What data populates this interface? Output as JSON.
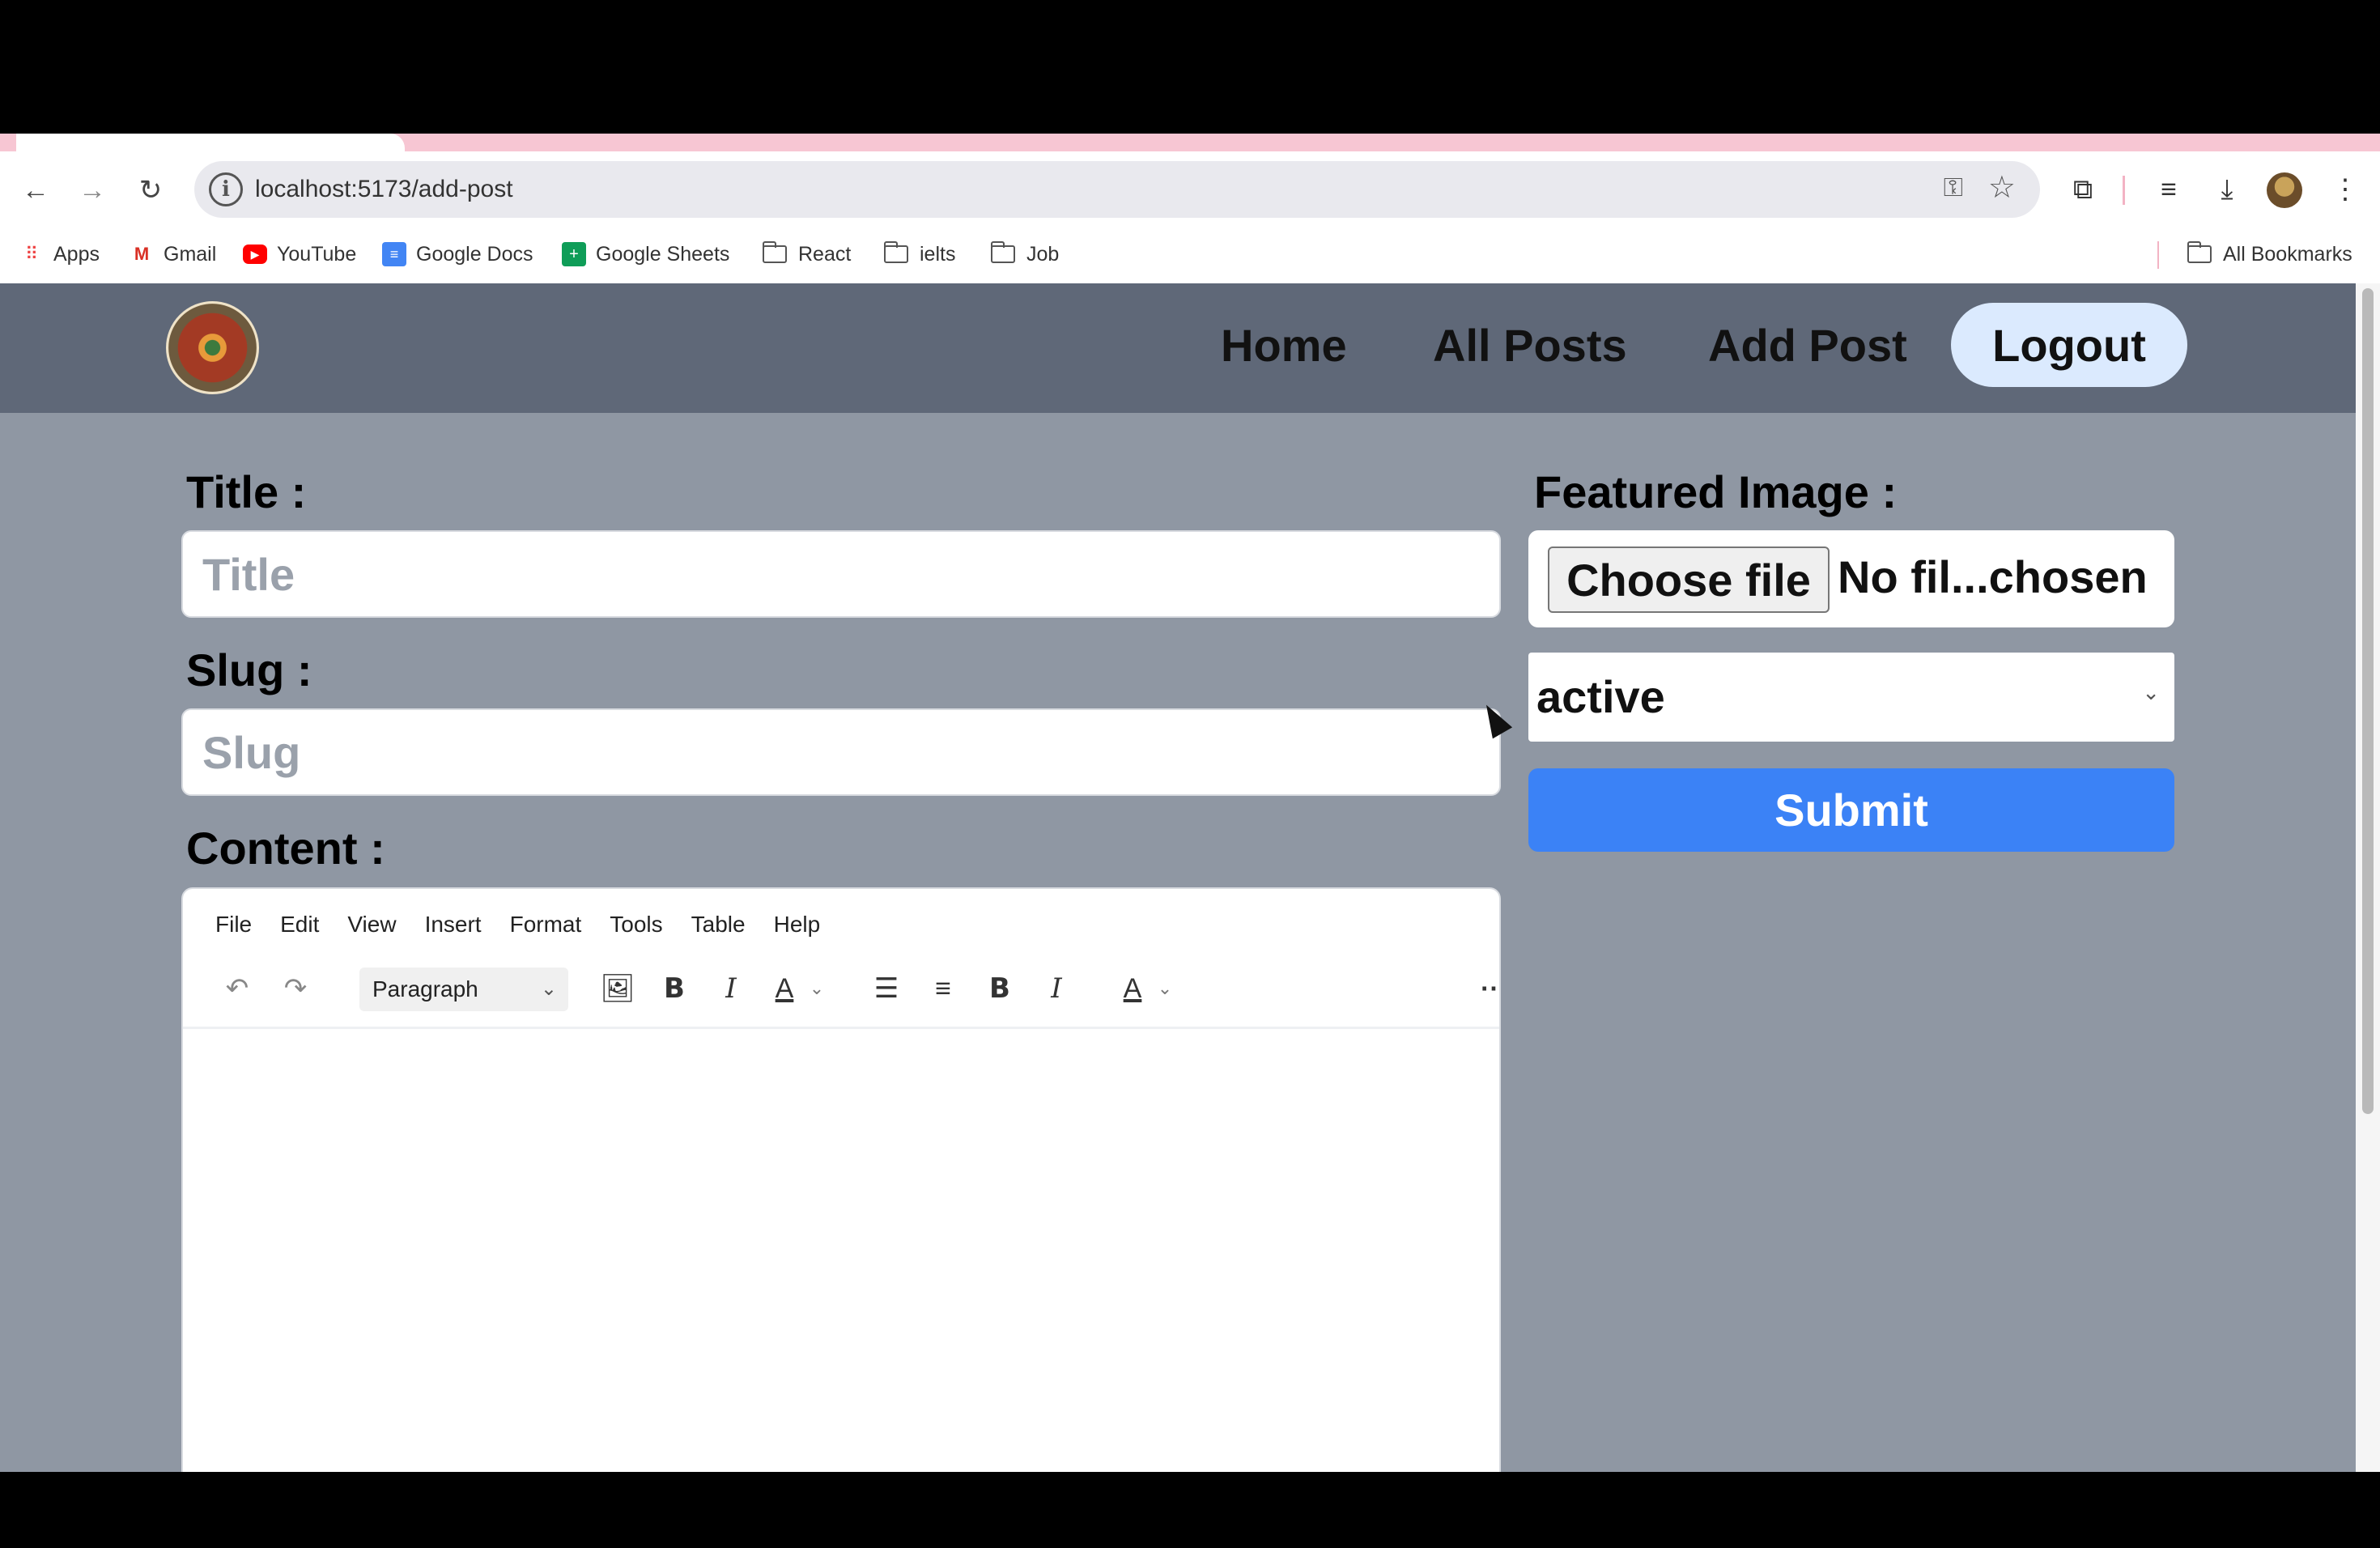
{
  "browser": {
    "url": "localhost:5173/add-post",
    "bookmarks": [
      {
        "label": "Apps"
      },
      {
        "label": "Gmail"
      },
      {
        "label": "YouTube"
      },
      {
        "label": "Google Docs"
      },
      {
        "label": "Google Sheets"
      },
      {
        "label": "React"
      },
      {
        "label": "ielts"
      },
      {
        "label": "Job"
      }
    ],
    "all_bookmarks": "All Bookmarks"
  },
  "header": {
    "nav": [
      "Home",
      "All Posts",
      "Add Post"
    ],
    "logout": "Logout"
  },
  "form": {
    "title_label": "Title :",
    "title_placeholder": "Title",
    "slug_label": "Slug :",
    "slug_placeholder": "Slug",
    "content_label": "Content :",
    "featured_label": "Featured Image :",
    "choose_file": "Choose file",
    "no_file": "No fil...chosen",
    "status_value": "active",
    "submit": "Submit"
  },
  "editor": {
    "menu": [
      "File",
      "Edit",
      "View",
      "Insert",
      "Format",
      "Tools",
      "Table",
      "Help"
    ],
    "block_format": "Paragraph"
  }
}
